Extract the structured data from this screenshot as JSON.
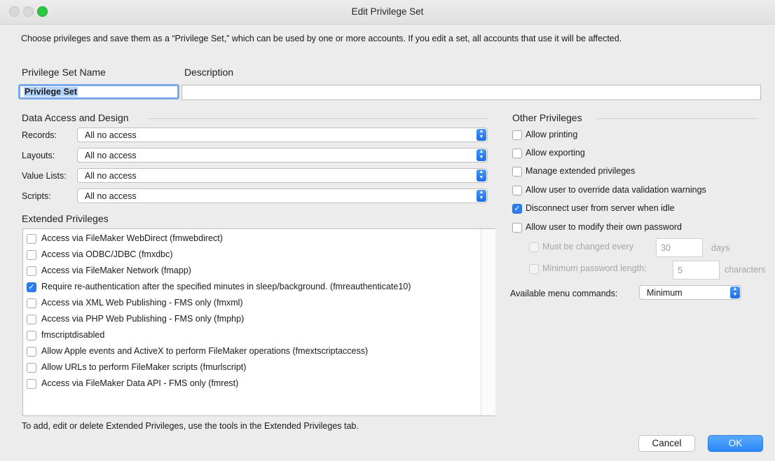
{
  "window": {
    "title": "Edit Privilege Set"
  },
  "intro": "Choose privileges and save them as a “Privilege Set,” which can be used by one or more accounts. If you edit a set, all accounts that use it will be affected.",
  "name": {
    "label": "Privilege Set Name",
    "value": "Privilege Set"
  },
  "description": {
    "label": "Description",
    "value": ""
  },
  "data_access": {
    "heading": "Data Access and Design",
    "rows": [
      {
        "label": "Records:",
        "value": "All no access"
      },
      {
        "label": "Layouts:",
        "value": "All no access"
      },
      {
        "label": "Value Lists:",
        "value": "All no access"
      },
      {
        "label": "Scripts:",
        "value": "All no access"
      }
    ]
  },
  "extended": {
    "heading": "Extended Privileges",
    "items": [
      {
        "label": "Access via FileMaker WebDirect (fmwebdirect)",
        "checked": false
      },
      {
        "label": "Access via ODBC/JDBC (fmxdbc)",
        "checked": false
      },
      {
        "label": "Access via FileMaker Network (fmapp)",
        "checked": false
      },
      {
        "label": "Require re-authentication after the specified minutes in sleep/background. (fmreauthenticate10)",
        "checked": true
      },
      {
        "label": "Access via XML Web Publishing - FMS only (fmxml)",
        "checked": false
      },
      {
        "label": "Access via PHP Web Publishing - FMS only (fmphp)",
        "checked": false
      },
      {
        "label": "fmscriptdisabled",
        "checked": false
      },
      {
        "label": "Allow Apple events and ActiveX to perform FileMaker operations (fmextscriptaccess)",
        "checked": false
      },
      {
        "label": "Allow URLs to perform FileMaker scripts (fmurlscript)",
        "checked": false
      },
      {
        "label": "Access via FileMaker Data API - FMS only (fmrest)",
        "checked": false
      }
    ],
    "footer": "To add, edit or delete Extended Privileges, use the tools in the Extended Privileges tab."
  },
  "other": {
    "heading": "Other Privileges",
    "items": [
      {
        "label": "Allow printing",
        "checked": false
      },
      {
        "label": "Allow exporting",
        "checked": false
      },
      {
        "label": "Manage extended privileges",
        "checked": false
      },
      {
        "label": "Allow user to override data validation warnings",
        "checked": false
      },
      {
        "label": "Disconnect user from server when idle",
        "checked": true
      },
      {
        "label": "Allow user to modify their own password",
        "checked": false
      }
    ],
    "must_change": {
      "label": "Must be changed every",
      "value": "30",
      "unit": "days"
    },
    "min_length": {
      "label": "Minimum password length:",
      "value": "5",
      "unit": "characters"
    },
    "menu_commands": {
      "label": "Available menu commands:",
      "value": "Minimum"
    }
  },
  "buttons": {
    "cancel": "Cancel",
    "ok": "OK"
  }
}
